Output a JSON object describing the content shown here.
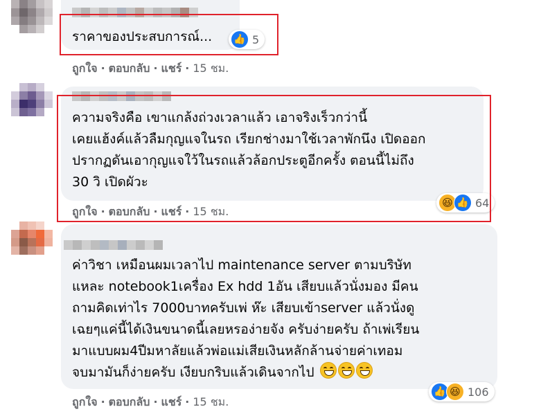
{
  "comments": [
    {
      "text": "ราคาของประสบการณ์...",
      "reaction_count": "5",
      "actions": {
        "like": "ถูกใจ",
        "reply": "ตอบกลับ",
        "share": "แชร์",
        "time": "15 ชม."
      }
    },
    {
      "text": "ความจริงคือ เขาแกล้งถ่วงเวลาแล้ว เอาจริงเร็วกว่านี้\nเคยแฮ้งค์แล้วลืมกุญแจในรถ เรียกช่างมาใช้เวลาพักนึง เปิดออก\nปรากฏดันเอากุญแจใว้ในรถแล้วล้อกประตูอีกครั้ง ตอนนี้ไม่ถึง\n30 วิ เปิดผัวะ",
      "reaction_count": "64",
      "actions": {
        "like": "ถูกใจ",
        "reply": "ตอบกลับ",
        "share": "แชร์",
        "time": "15 ชม."
      }
    },
    {
      "text": "ค่าวิชา เหมือนผมเวลาไป maintenance server ตามบริษัท\nแหละ notebook1เครื่อง Ex hdd 1อัน เสียบแล้วนั่งมอง มีคน\nถามคิดเท่าไร 7000บาทครับเพ่ ห๊ะ เสียบเข้าserver แล้วนั่งดู\nเฉยๆแค่นี้ได้เงินขนาดนี้เลยหรอง่ายจัง ครับง่ายครับ ถ้าเพ่เรียน\nมาแบบผม4ปีมหาลัยแล้วพ่อแม่เสียเงินหลักล้านจ่ายค่าเทอม\nจบมามันก็ง่ายครับ เงียบกริบแล้วเดินจากไป",
      "reaction_count": "106",
      "actions": {
        "like": "ถูกใจ",
        "reply": "ตอบกลับ",
        "share": "แชร์",
        "time": "15 ชม."
      }
    }
  ],
  "icons": {
    "like": "like-reaction-icon",
    "haha": "haha-reaction-icon",
    "grin": "grinning-emoji-icon"
  },
  "colors": {
    "like": "#1877f2",
    "haha": "#f7b125",
    "highlight": "#e0222b",
    "bubble": "#f0f2f5",
    "meta": "#65676b"
  }
}
